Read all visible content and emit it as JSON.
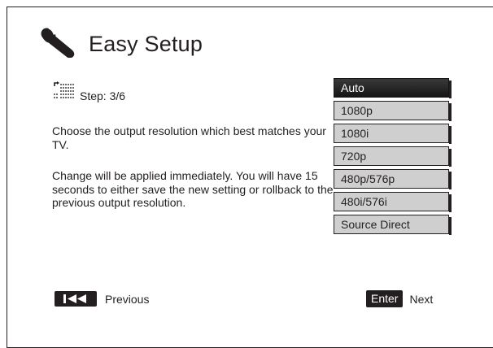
{
  "header": {
    "icon": "wrench-icon",
    "title": "Easy Setup"
  },
  "step": {
    "icon": "grid-step-icon",
    "label": "Step: 3/6"
  },
  "description": {
    "line1": "Choose the output resolution which best matches your TV.",
    "line2": "Change will be applied immediately.  You will have 15 seconds to either save the new setting or rollback to the previous output resolution."
  },
  "options": {
    "selected": "Auto",
    "items": [
      "Auto",
      "1080p",
      "1080i",
      "720p",
      "480p/576p",
      "480i/576i",
      "Source Direct"
    ]
  },
  "nav": {
    "previous_icon": "skip-back-icon",
    "previous_label": "Previous",
    "enter_label": "Enter",
    "next_label": "Next"
  },
  "colors": {
    "selected_bg": "#1f1f1f",
    "option_bg": "#cfcfcf",
    "text": "#231f20"
  }
}
